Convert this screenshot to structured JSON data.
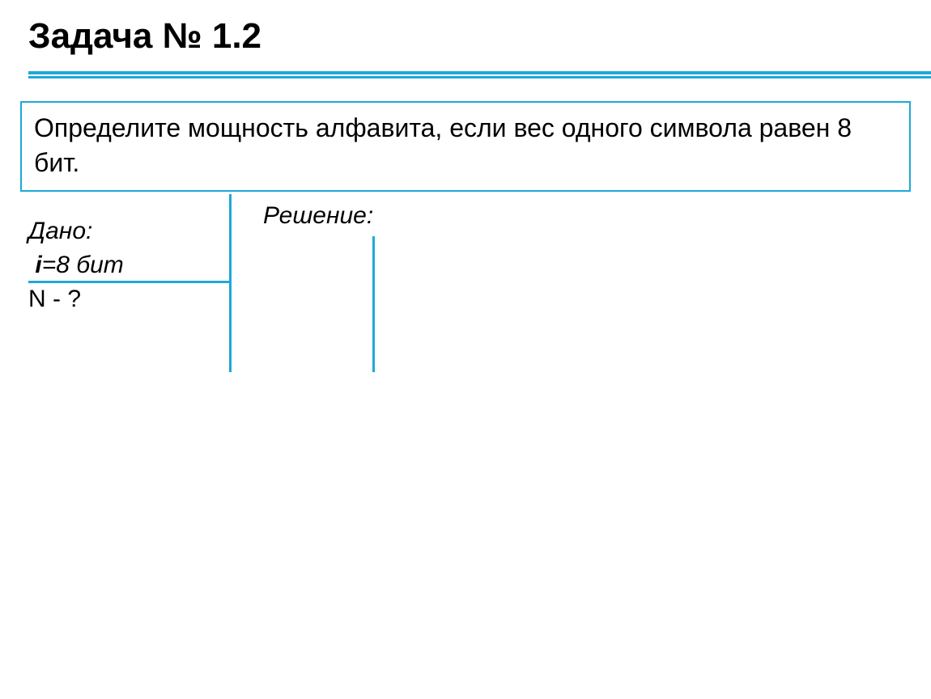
{
  "title": "Задача № 1.2",
  "problem_text": "Определите мощность алфавита, если вес одного символа равен 8 бит.",
  "given": {
    "label": "Дано:",
    "item1_var": "i",
    "item1_rest": "=8 бит",
    "find": "N -  ?"
  },
  "solution_label": "Решение:"
}
